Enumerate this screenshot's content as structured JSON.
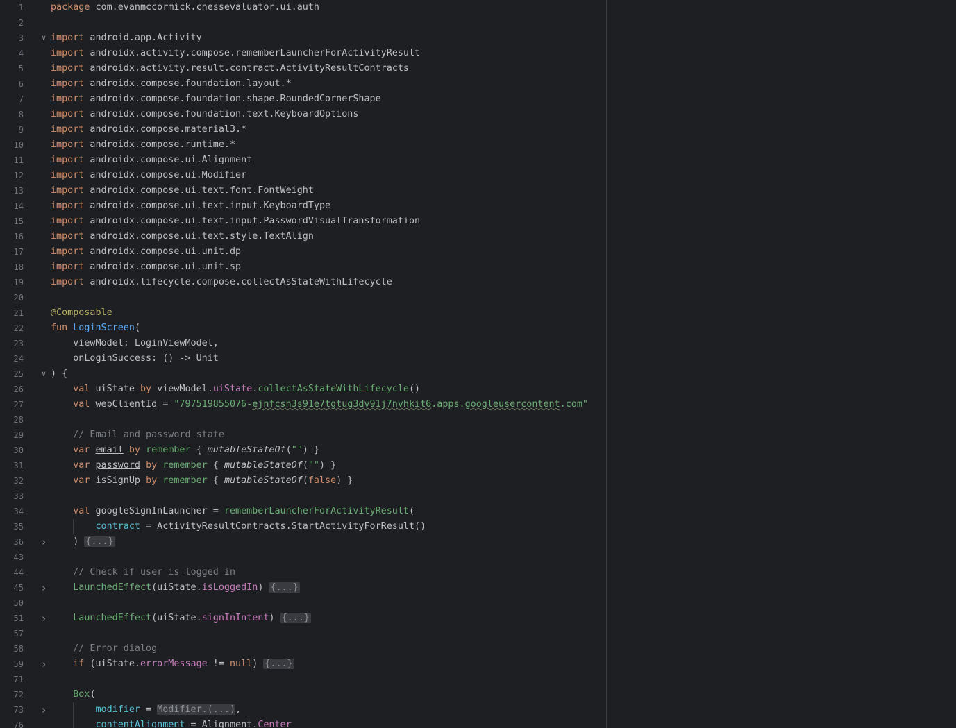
{
  "editor": {
    "language": "Kotlin",
    "lines": [
      {
        "n": "1",
        "fold": "",
        "indent": 0,
        "tokens": [
          {
            "t": "package",
            "c": "kw"
          },
          {
            "t": " com.evanmccormick.chessevaluator.ui.auth",
            "c": ""
          }
        ]
      },
      {
        "n": "2",
        "fold": "",
        "indent": 0,
        "tokens": []
      },
      {
        "n": "3",
        "fold": "open",
        "indent": 0,
        "tokens": [
          {
            "t": "import",
            "c": "kw"
          },
          {
            "t": " android.app.Activity",
            "c": ""
          }
        ]
      },
      {
        "n": "4",
        "fold": "",
        "indent": 0,
        "tokens": [
          {
            "t": "import",
            "c": "kw"
          },
          {
            "t": " androidx.activity.compose.rememberLauncherForActivityResult",
            "c": ""
          }
        ]
      },
      {
        "n": "5",
        "fold": "",
        "indent": 0,
        "tokens": [
          {
            "t": "import",
            "c": "kw"
          },
          {
            "t": " androidx.activity.result.contract.ActivityResultContracts",
            "c": ""
          }
        ]
      },
      {
        "n": "6",
        "fold": "",
        "indent": 0,
        "tokens": [
          {
            "t": "import",
            "c": "kw"
          },
          {
            "t": " androidx.compose.foundation.layout.*",
            "c": ""
          }
        ]
      },
      {
        "n": "7",
        "fold": "",
        "indent": 0,
        "tokens": [
          {
            "t": "import",
            "c": "kw"
          },
          {
            "t": " androidx.compose.foundation.shape.RoundedCornerShape",
            "c": ""
          }
        ]
      },
      {
        "n": "8",
        "fold": "",
        "indent": 0,
        "tokens": [
          {
            "t": "import",
            "c": "kw"
          },
          {
            "t": " androidx.compose.foundation.text.KeyboardOptions",
            "c": ""
          }
        ]
      },
      {
        "n": "9",
        "fold": "",
        "indent": 0,
        "tokens": [
          {
            "t": "import",
            "c": "kw"
          },
          {
            "t": " androidx.compose.material3.*",
            "c": ""
          }
        ]
      },
      {
        "n": "10",
        "fold": "",
        "indent": 0,
        "tokens": [
          {
            "t": "import",
            "c": "kw"
          },
          {
            "t": " androidx.compose.runtime.*",
            "c": ""
          }
        ]
      },
      {
        "n": "11",
        "fold": "",
        "indent": 0,
        "tokens": [
          {
            "t": "import",
            "c": "kw"
          },
          {
            "t": " androidx.compose.ui.Alignment",
            "c": ""
          }
        ]
      },
      {
        "n": "12",
        "fold": "",
        "indent": 0,
        "tokens": [
          {
            "t": "import",
            "c": "kw"
          },
          {
            "t": " androidx.compose.ui.Modifier",
            "c": ""
          }
        ]
      },
      {
        "n": "13",
        "fold": "",
        "indent": 0,
        "tokens": [
          {
            "t": "import",
            "c": "kw"
          },
          {
            "t": " androidx.compose.ui.text.font.FontWeight",
            "c": ""
          }
        ]
      },
      {
        "n": "14",
        "fold": "",
        "indent": 0,
        "tokens": [
          {
            "t": "import",
            "c": "kw"
          },
          {
            "t": " androidx.compose.ui.text.input.KeyboardType",
            "c": ""
          }
        ]
      },
      {
        "n": "15",
        "fold": "",
        "indent": 0,
        "tokens": [
          {
            "t": "import",
            "c": "kw"
          },
          {
            "t": " androidx.compose.ui.text.input.PasswordVisualTransformation",
            "c": ""
          }
        ]
      },
      {
        "n": "16",
        "fold": "",
        "indent": 0,
        "tokens": [
          {
            "t": "import",
            "c": "kw"
          },
          {
            "t": " androidx.compose.ui.text.style.TextAlign",
            "c": ""
          }
        ]
      },
      {
        "n": "17",
        "fold": "",
        "indent": 0,
        "tokens": [
          {
            "t": "import",
            "c": "kw"
          },
          {
            "t": " androidx.compose.ui.unit.dp",
            "c": ""
          }
        ]
      },
      {
        "n": "18",
        "fold": "",
        "indent": 0,
        "tokens": [
          {
            "t": "import",
            "c": "kw"
          },
          {
            "t": " androidx.compose.ui.unit.sp",
            "c": ""
          }
        ]
      },
      {
        "n": "19",
        "fold": "",
        "indent": 0,
        "tokens": [
          {
            "t": "import",
            "c": "kw"
          },
          {
            "t": " androidx.lifecycle.compose.collectAsStateWithLifecycle",
            "c": ""
          }
        ]
      },
      {
        "n": "20",
        "fold": "",
        "indent": 0,
        "tokens": []
      },
      {
        "n": "21",
        "fold": "",
        "indent": 0,
        "tokens": [
          {
            "t": "@Composable",
            "c": "ann"
          }
        ]
      },
      {
        "n": "22",
        "fold": "",
        "indent": 0,
        "tokens": [
          {
            "t": "fun",
            "c": "kw"
          },
          {
            "t": " ",
            "c": ""
          },
          {
            "t": "LoginScreen",
            "c": "fn"
          },
          {
            "t": "(",
            "c": ""
          }
        ]
      },
      {
        "n": "23",
        "fold": "",
        "indent": 0,
        "tokens": [
          {
            "t": "    viewModel: LoginViewModel,",
            "c": ""
          }
        ]
      },
      {
        "n": "24",
        "fold": "",
        "indent": 0,
        "tokens": [
          {
            "t": "    onLoginSuccess: () -> Unit",
            "c": ""
          }
        ]
      },
      {
        "n": "25",
        "fold": "open",
        "indent": 0,
        "tokens": [
          {
            "t": ") {",
            "c": ""
          }
        ]
      },
      {
        "n": "26",
        "fold": "",
        "indent": 0,
        "tokens": [
          {
            "t": "    ",
            "c": ""
          },
          {
            "t": "val",
            "c": "kw"
          },
          {
            "t": " uiState ",
            "c": ""
          },
          {
            "t": "by",
            "c": "kw"
          },
          {
            "t": " viewModel.",
            "c": ""
          },
          {
            "t": "uiState",
            "c": "prop"
          },
          {
            "t": ".",
            "c": ""
          },
          {
            "t": "collectAsStateWithLifecycle",
            "c": "lam"
          },
          {
            "t": "()",
            "c": ""
          }
        ]
      },
      {
        "n": "27",
        "fold": "",
        "indent": 0,
        "tokens": [
          {
            "t": "    ",
            "c": ""
          },
          {
            "t": "val",
            "c": "kw"
          },
          {
            "t": " webClientId = ",
            "c": ""
          },
          {
            "t": "\"797519855076-",
            "c": "str"
          },
          {
            "t": "ejnfcsh3s91e7tgtug3dv91j7nvhkit6",
            "c": "str typo"
          },
          {
            "t": ".apps.",
            "c": "str"
          },
          {
            "t": "googleusercontent",
            "c": "str typo"
          },
          {
            "t": ".com\"",
            "c": "str"
          }
        ]
      },
      {
        "n": "28",
        "fold": "",
        "indent": 0,
        "tokens": []
      },
      {
        "n": "29",
        "fold": "",
        "indent": 0,
        "tokens": [
          {
            "t": "    ",
            "c": ""
          },
          {
            "t": "// Email and password state",
            "c": "cm"
          }
        ]
      },
      {
        "n": "30",
        "fold": "",
        "indent": 0,
        "tokens": [
          {
            "t": "    ",
            "c": ""
          },
          {
            "t": "var",
            "c": "kw"
          },
          {
            "t": " ",
            "c": ""
          },
          {
            "t": "email",
            "c": "ul"
          },
          {
            "t": " ",
            "c": ""
          },
          {
            "t": "by",
            "c": "kw"
          },
          {
            "t": " ",
            "c": ""
          },
          {
            "t": "remember",
            "c": "lam"
          },
          {
            "t": " { ",
            "c": ""
          },
          {
            "t": "mutableStateOf",
            "c": "it"
          },
          {
            "t": "(",
            "c": ""
          },
          {
            "t": "\"\"",
            "c": "str"
          },
          {
            "t": ") }",
            "c": ""
          }
        ]
      },
      {
        "n": "31",
        "fold": "",
        "indent": 0,
        "tokens": [
          {
            "t": "    ",
            "c": ""
          },
          {
            "t": "var",
            "c": "kw"
          },
          {
            "t": " ",
            "c": ""
          },
          {
            "t": "password",
            "c": "ul"
          },
          {
            "t": " ",
            "c": ""
          },
          {
            "t": "by",
            "c": "kw"
          },
          {
            "t": " ",
            "c": ""
          },
          {
            "t": "remember",
            "c": "lam"
          },
          {
            "t": " { ",
            "c": ""
          },
          {
            "t": "mutableStateOf",
            "c": "it"
          },
          {
            "t": "(",
            "c": ""
          },
          {
            "t": "\"\"",
            "c": "str"
          },
          {
            "t": ") }",
            "c": ""
          }
        ]
      },
      {
        "n": "32",
        "fold": "",
        "indent": 0,
        "tokens": [
          {
            "t": "    ",
            "c": ""
          },
          {
            "t": "var",
            "c": "kw"
          },
          {
            "t": " ",
            "c": ""
          },
          {
            "t": "isSignUp",
            "c": "ul"
          },
          {
            "t": " ",
            "c": ""
          },
          {
            "t": "by",
            "c": "kw"
          },
          {
            "t": " ",
            "c": ""
          },
          {
            "t": "remember",
            "c": "lam"
          },
          {
            "t": " { ",
            "c": ""
          },
          {
            "t": "mutableStateOf",
            "c": "it"
          },
          {
            "t": "(",
            "c": ""
          },
          {
            "t": "false",
            "c": "kw"
          },
          {
            "t": ") }",
            "c": ""
          }
        ]
      },
      {
        "n": "33",
        "fold": "",
        "indent": 0,
        "tokens": []
      },
      {
        "n": "34",
        "fold": "",
        "indent": 0,
        "tokens": [
          {
            "t": "    ",
            "c": ""
          },
          {
            "t": "val",
            "c": "kw"
          },
          {
            "t": " googleSignInLauncher = ",
            "c": ""
          },
          {
            "t": "rememberLauncherForActivityResult",
            "c": "lam"
          },
          {
            "t": "(",
            "c": ""
          }
        ]
      },
      {
        "n": "35",
        "fold": "",
        "indent": 1,
        "tokens": [
          {
            "t": "        ",
            "c": ""
          },
          {
            "t": "contract",
            "c": "param"
          },
          {
            "t": " = ActivityResultContracts.StartActivityForResult()",
            "c": ""
          }
        ]
      },
      {
        "n": "36",
        "fold": "closed",
        "indent": 0,
        "tokens": [
          {
            "t": "    ) ",
            "c": ""
          },
          {
            "t": "{...}",
            "c": "folded"
          }
        ]
      },
      {
        "n": "43",
        "fold": "",
        "indent": 0,
        "tokens": []
      },
      {
        "n": "44",
        "fold": "",
        "indent": 0,
        "tokens": [
          {
            "t": "    ",
            "c": ""
          },
          {
            "t": "// Check if user is logged in",
            "c": "cm"
          }
        ]
      },
      {
        "n": "45",
        "fold": "closed",
        "indent": 0,
        "tokens": [
          {
            "t": "    ",
            "c": ""
          },
          {
            "t": "LaunchedEffect",
            "c": "lam"
          },
          {
            "t": "(uiState.",
            "c": ""
          },
          {
            "t": "isLoggedIn",
            "c": "prop"
          },
          {
            "t": ") ",
            "c": ""
          },
          {
            "t": "{...}",
            "c": "folded"
          }
        ]
      },
      {
        "n": "50",
        "fold": "",
        "indent": 0,
        "tokens": []
      },
      {
        "n": "51",
        "fold": "closed",
        "indent": 0,
        "tokens": [
          {
            "t": "    ",
            "c": ""
          },
          {
            "t": "LaunchedEffect",
            "c": "lam"
          },
          {
            "t": "(uiState.",
            "c": ""
          },
          {
            "t": "signInIntent",
            "c": "prop"
          },
          {
            "t": ") ",
            "c": ""
          },
          {
            "t": "{...}",
            "c": "folded"
          }
        ]
      },
      {
        "n": "57",
        "fold": "",
        "indent": 0,
        "tokens": []
      },
      {
        "n": "58",
        "fold": "",
        "indent": 0,
        "tokens": [
          {
            "t": "    ",
            "c": ""
          },
          {
            "t": "// Error dialog",
            "c": "cm"
          }
        ]
      },
      {
        "n": "59",
        "fold": "closed",
        "indent": 0,
        "tokens": [
          {
            "t": "    ",
            "c": ""
          },
          {
            "t": "if",
            "c": "kw"
          },
          {
            "t": " (uiState.",
            "c": ""
          },
          {
            "t": "errorMessage",
            "c": "prop"
          },
          {
            "t": " != ",
            "c": ""
          },
          {
            "t": "null",
            "c": "kw"
          },
          {
            "t": ") ",
            "c": ""
          },
          {
            "t": "{...}",
            "c": "folded"
          }
        ]
      },
      {
        "n": "71",
        "fold": "",
        "indent": 0,
        "tokens": []
      },
      {
        "n": "72",
        "fold": "",
        "indent": 0,
        "tokens": [
          {
            "t": "    ",
            "c": ""
          },
          {
            "t": "Box",
            "c": "lam"
          },
          {
            "t": "(",
            "c": ""
          }
        ]
      },
      {
        "n": "73",
        "fold": "closed",
        "indent": 1,
        "tokens": [
          {
            "t": "        ",
            "c": ""
          },
          {
            "t": "modifier",
            "c": "param"
          },
          {
            "t": " = ",
            "c": ""
          },
          {
            "t": "Modifier.(...)",
            "c": "folded-expr"
          },
          {
            "t": ",",
            "c": ""
          }
        ]
      },
      {
        "n": "76",
        "fold": "",
        "indent": 1,
        "tokens": [
          {
            "t": "        ",
            "c": ""
          },
          {
            "t": "contentAlignment",
            "c": "param"
          },
          {
            "t": " = Alignment.",
            "c": ""
          },
          {
            "t": "Center",
            "c": "prop"
          }
        ]
      }
    ]
  }
}
